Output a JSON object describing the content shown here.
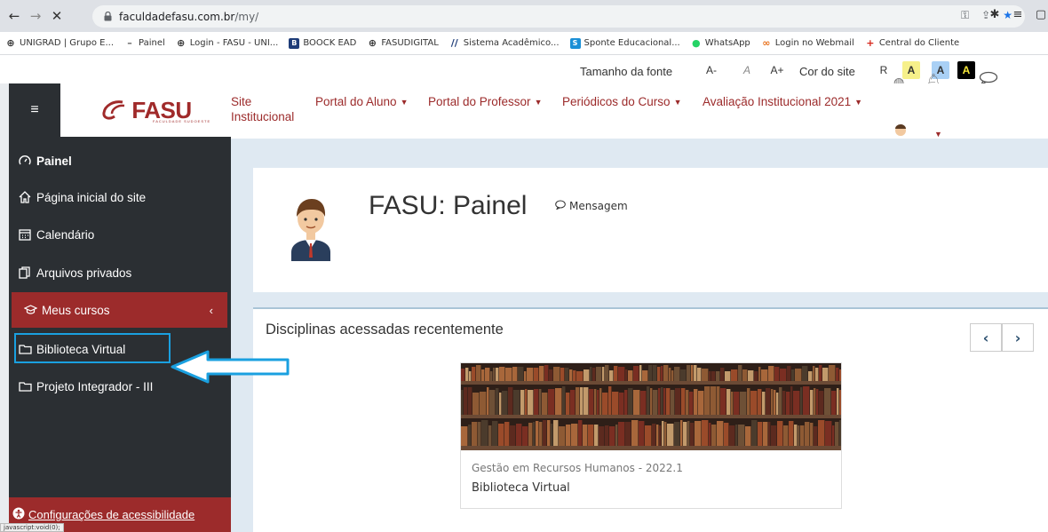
{
  "browser": {
    "url_domain": "faculdadefasu.com.br",
    "url_path": "/my/",
    "bookmarks": [
      {
        "label": "UNIGRAD | Grupo E...",
        "icon": "globe-icon",
        "color": "#333333"
      },
      {
        "label": "Painel",
        "icon": "dash-icon",
        "color": "#666666"
      },
      {
        "label": "Login - FASU - UNI...",
        "icon": "globe-icon",
        "color": "#333333"
      },
      {
        "label": "BOOCK EAD",
        "icon": "b-icon",
        "color": "#1e3c78"
      },
      {
        "label": "FASUDIGITAL",
        "icon": "globe-icon",
        "color": "#333333"
      },
      {
        "label": "Sistema Acadêmico...",
        "icon": "slash-icon",
        "color": "#1e3c78"
      },
      {
        "label": "Sponte Educacional...",
        "icon": "s-icon",
        "color": "#1a8fd6"
      },
      {
        "label": "WhatsApp",
        "icon": "whatsapp-icon",
        "color": "#25d366"
      },
      {
        "label": "Login no Webmail",
        "icon": "webmail-icon",
        "color": "#e8701a"
      },
      {
        "label": "Central do Cliente",
        "icon": "plus-icon",
        "color": "#d6251a"
      }
    ]
  },
  "a11y": {
    "font_label": "Tamanho da fonte",
    "font_minus": "A-",
    "font_reset": "A",
    "font_plus": "A+",
    "color_label": "Cor do site",
    "swatch_r": "R",
    "swatch_a1": "A",
    "swatch_a2": "A",
    "swatch_a3": "A"
  },
  "sidebar": {
    "items": [
      {
        "label": "Painel",
        "icon": "gauge-icon"
      },
      {
        "label": "Página inicial do site",
        "icon": "home-icon"
      },
      {
        "label": "Calendário",
        "icon": "calendar-icon"
      },
      {
        "label": "Arquivos privados",
        "icon": "files-icon"
      },
      {
        "label": "Meus cursos",
        "icon": "graduation-cap-icon"
      },
      {
        "label": "Biblioteca Virtual",
        "icon": "folder-icon"
      },
      {
        "label": "Projeto Integrador - III",
        "icon": "folder-icon"
      }
    ],
    "config_label": "Configurações de acessibilidade",
    "status_text": "javascript:void(0);"
  },
  "logo": {
    "text": "FASU",
    "sub": "FACULDADE SUDOESTE"
  },
  "topnav": {
    "site_line1": "Site",
    "site_line2": "Institucional",
    "items": [
      "Portal do Aluno",
      "Portal do Professor",
      "Periódicos do Curso",
      "Avaliação Institucional 2021"
    ]
  },
  "main": {
    "title": "FASU: Painel",
    "message_label": "Mensagem",
    "recent_title": "Disciplinas acessadas recentemente",
    "course": {
      "category": "Gestão em Recursos Humanos - 2022.1",
      "name": "Biblioteca Virtual"
    }
  },
  "colors": {
    "brand": "#9c2b2b",
    "sidebar_bg": "#2b2f33",
    "highlight": "#1aa0e0"
  }
}
